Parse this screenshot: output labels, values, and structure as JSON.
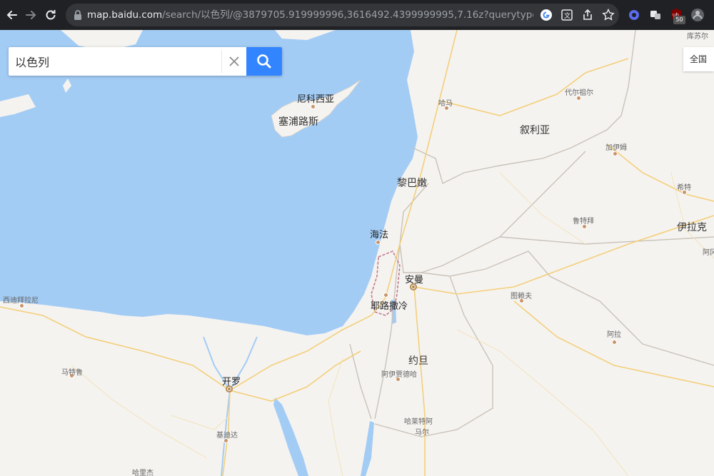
{
  "browser": {
    "url_host": "map.baidu.com",
    "url_path": "/search/以色列/@3879705.919999996,3616492.4399999995,7.16z?querytype=s&da_...",
    "extension_badge": "50",
    "icons": [
      "back-arrow-icon",
      "forward-arrow-icon",
      "reload-icon",
      "lock-icon",
      "google-icon",
      "translate-icon",
      "share-icon",
      "star-icon",
      "extension-gear-icon",
      "extension-puzzle-icon",
      "extension-ublock-icon",
      "profile-icon"
    ]
  },
  "search": {
    "query": "以色列",
    "clear_label": "×",
    "search_icon": "magnifier-icon"
  },
  "region": {
    "label": "全国",
    "chevron": "chevron-down-icon"
  },
  "map": {
    "colors": {
      "water": "#a3ccf5",
      "land": "#f5f3f0",
      "road_major": "#f7d98a",
      "road_minor": "#f3e2b3",
      "border": "#c9c2b8",
      "dispute_border": "#c27a8f"
    },
    "labels": [
      {
        "id": "cyprus",
        "text": "塞浦路斯",
        "kind": "country"
      },
      {
        "id": "nicosia",
        "text": "尼科西亚",
        "kind": "capital"
      },
      {
        "id": "syria",
        "text": "叙利亚",
        "kind": "country"
      },
      {
        "id": "lebanon",
        "text": "黎巴嫩",
        "kind": "country"
      },
      {
        "id": "haifa",
        "text": "海法",
        "kind": "capital"
      },
      {
        "id": "amman",
        "text": "安曼",
        "kind": "capital"
      },
      {
        "id": "jerusalem",
        "text": "耶路撒冷",
        "kind": "capital"
      },
      {
        "id": "jordan",
        "text": "约旦",
        "kind": "country"
      },
      {
        "id": "iraq",
        "text": "伊拉克",
        "kind": "country"
      },
      {
        "id": "cairo",
        "text": "开罗",
        "kind": "capital"
      },
      {
        "id": "hama",
        "text": "哈马",
        "kind": "city"
      },
      {
        "id": "deir",
        "text": "代尔祖尔",
        "kind": "city"
      },
      {
        "id": "qaim",
        "text": "加伊姆",
        "kind": "city"
      },
      {
        "id": "hit",
        "text": "希特",
        "kind": "city"
      },
      {
        "id": "rutba",
        "text": "鲁特拜",
        "kind": "city"
      },
      {
        "id": "tulayhat",
        "text": "图赖夫",
        "kind": "city"
      },
      {
        "id": "arar",
        "text": "阿拉",
        "kind": "city"
      },
      {
        "id": "ma_an",
        "text": "阿伊贾德哈",
        "kind": "city"
      },
      {
        "id": "hafr",
        "text": "哈莱特阿",
        "kind": "city"
      },
      {
        "id": "mar",
        "text": "马尔",
        "kind": "city"
      },
      {
        "id": "matruh",
        "text": "马特鲁",
        "kind": "city"
      },
      {
        "id": "suez",
        "text": "基迪达",
        "kind": "city"
      },
      {
        "id": "aleppo_top",
        "text": "库苏尔",
        "kind": "city"
      },
      {
        "id": "western",
        "text": "西迪拜拉尼",
        "kind": "city"
      },
      {
        "id": "hurghada",
        "text": "哈里杰",
        "kind": "city"
      },
      {
        "id": "abad",
        "text": "阿冈",
        "kind": "city"
      }
    ]
  }
}
